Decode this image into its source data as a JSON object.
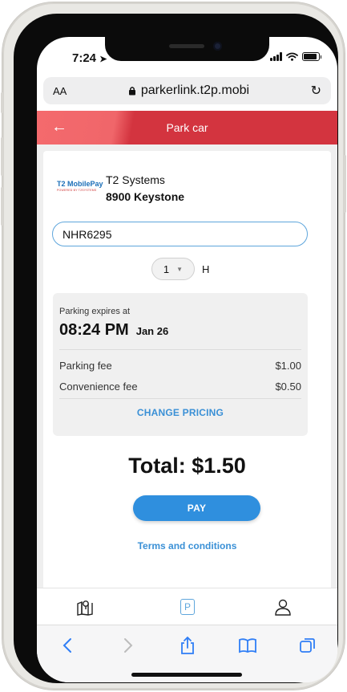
{
  "status_bar": {
    "time": "7:24"
  },
  "browser": {
    "text_size_label": "AA",
    "url": "parkerlink.t2p.mobi"
  },
  "header": {
    "title": "Park car"
  },
  "vendor": {
    "logo_text": "T2 MobilePay",
    "logo_subtext": "POWERED BY T2SYSTEMS",
    "name": "T2 Systems",
    "location": "8900 Keystone"
  },
  "plate": {
    "value": "NHR6295"
  },
  "duration": {
    "value": "1",
    "unit": "H"
  },
  "summary": {
    "expires_label": "Parking expires at",
    "expires_time": "08:24 PM",
    "expires_date": "Jan 26",
    "fees": [
      {
        "label": "Parking fee",
        "amount": "$1.00"
      },
      {
        "label": "Convenience fee",
        "amount": "$0.50"
      }
    ],
    "change_pricing_label": "CHANGE PRICING"
  },
  "total": {
    "label": "Total: $1.50"
  },
  "actions": {
    "pay_label": "PAY",
    "terms_label": "Terms and conditions"
  },
  "tab_bar": {
    "items": [
      {
        "icon": "map-pin-icon"
      },
      {
        "icon": "parking-icon",
        "label": "P"
      },
      {
        "icon": "account-icon"
      }
    ]
  },
  "safari_toolbar": {
    "items": [
      "back-icon",
      "forward-icon",
      "share-icon",
      "bookmarks-icon",
      "tabs-icon"
    ]
  },
  "colors": {
    "header_gradient_light": "#f46a6d",
    "header_gradient_dark": "#d3343f",
    "accent_blue": "#2f8fde",
    "link_blue": "#3a90d6",
    "input_border": "#5fa6dc"
  }
}
